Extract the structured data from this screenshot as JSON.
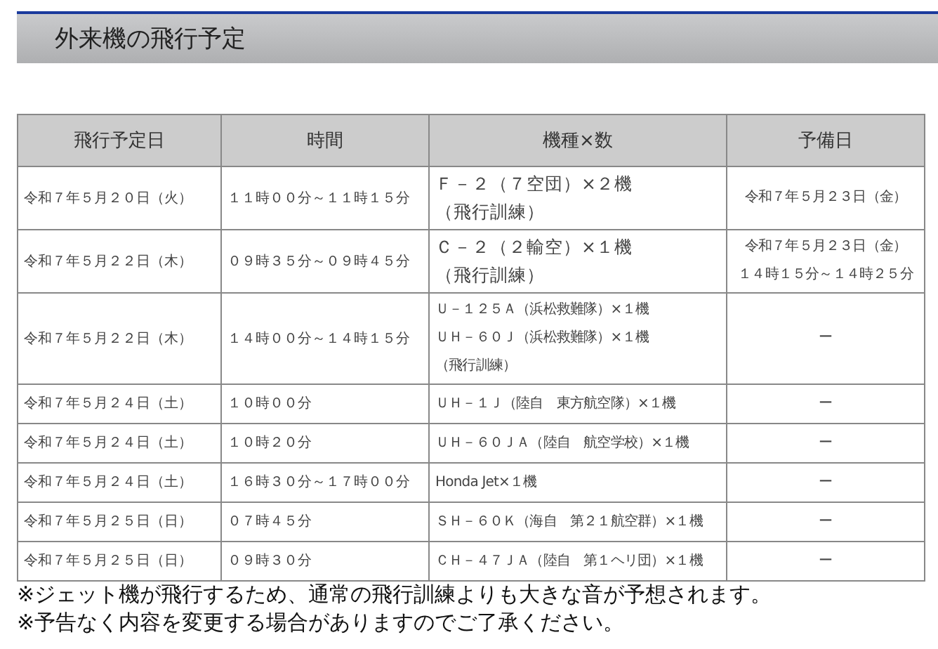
{
  "title": "外来機の飛行予定",
  "table": {
    "columns": [
      "飛行予定日",
      "時間",
      "機種×数",
      "予備日"
    ],
    "rows": [
      {
        "date": "令和７年５月２０日（火）",
        "time": "１１時００分～１１時１５分",
        "aircraft": [
          "Ｆ－２（７空団）×２機",
          "（飛行訓練）"
        ],
        "reserve": [
          "令和７年５月２３日（金）"
        ]
      },
      {
        "date": "令和７年５月２２日（木）",
        "time": "０９時３５分～０９時４５分",
        "aircraft": [
          "Ｃ－２（２輸空）×１機",
          "（飛行訓練）"
        ],
        "reserve": [
          "令和７年５月２３日（金）",
          "１４時１５分～１４時２５分"
        ]
      },
      {
        "date": "令和７年５月２２日（木）",
        "time": "１４時００分～１４時１５分",
        "aircraft": [
          "Ｕ－１２５Ａ（浜松救難隊）×１機",
          "ＵＨ－６０Ｊ（浜松救難隊）×１機",
          "（飛行訓練）"
        ],
        "reserve": [
          "ー"
        ]
      },
      {
        "date": "令和７年５月２４日（土）",
        "time": "１０時００分",
        "aircraft": [
          "ＵＨ－１Ｊ（陸自　東方航空隊）×１機"
        ],
        "reserve": [
          "ー"
        ]
      },
      {
        "date": "令和７年５月２４日（土）",
        "time": "１０時２０分",
        "aircraft": [
          "ＵＨ－６０ＪＡ（陸自　航空学校）×１機"
        ],
        "reserve": [
          "ー"
        ]
      },
      {
        "date": "令和７年５月２４日（土）",
        "time": "１６時３０分～１７時００分",
        "aircraft": [
          "Honda Jet×１機"
        ],
        "reserve": [
          "ー"
        ]
      },
      {
        "date": "令和７年５月２５日（日）",
        "time": "０７時４５分",
        "aircraft": [
          "ＳＨ－６０Ｋ（海自　第２１航空群）×１機"
        ],
        "reserve": [
          "ー"
        ]
      },
      {
        "date": "令和７年５月２５日（日）",
        "time": "０９時３０分",
        "aircraft": [
          "ＣＨ－４７ＪＡ（陸自　第１ヘリ団）×１機"
        ],
        "reserve": [
          "ー"
        ]
      }
    ]
  },
  "notes": [
    "※ジェット機が飛行するため、通常の飛行訓練よりも大きな音が予想されます。",
    "※予告なく内容を変更する場合がありますのでご了承ください。"
  ]
}
